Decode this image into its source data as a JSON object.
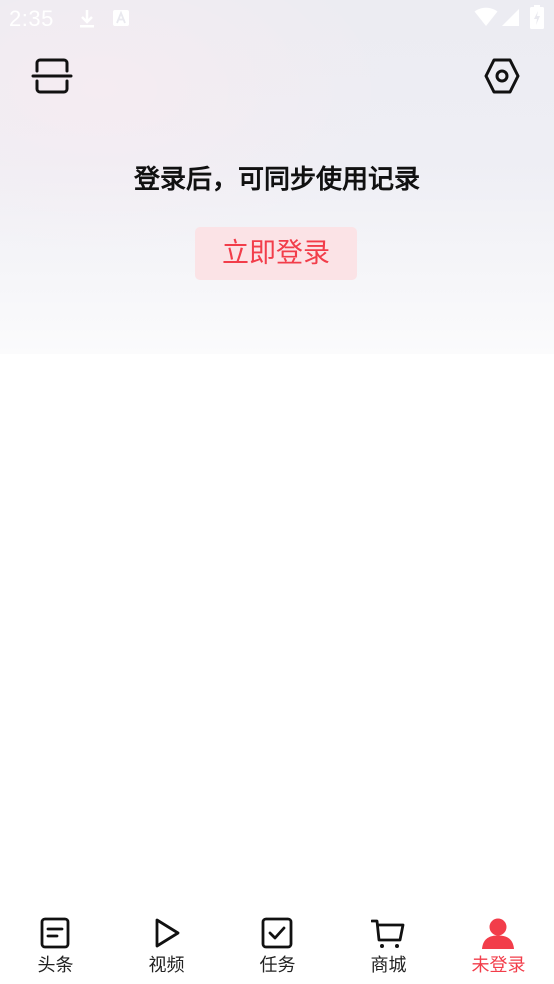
{
  "status_bar": {
    "time": "2:35",
    "icons": [
      "download-icon",
      "a-notification-icon",
      "wifi-icon",
      "cellular-signal-icon",
      "battery-icon"
    ]
  },
  "header": {
    "scan_icon": "scan-icon",
    "settings_icon": "settings-icon"
  },
  "login": {
    "prompt": "登录后，可同步使用记录",
    "button_label": "立即登录"
  },
  "bottom_nav": {
    "items": [
      {
        "label": "头条",
        "icon": "news-icon"
      },
      {
        "label": "视频",
        "icon": "video-play-icon"
      },
      {
        "label": "任务",
        "icon": "task-check-icon"
      },
      {
        "label": "商城",
        "icon": "shopping-cart-icon"
      },
      {
        "label": "未登录",
        "icon": "user-icon",
        "active": true
      }
    ]
  },
  "colors": {
    "accent": "#f23d4a",
    "login_button_bg": "#fbe3e6",
    "text_primary": "#111111",
    "nav_text": "#222222"
  }
}
